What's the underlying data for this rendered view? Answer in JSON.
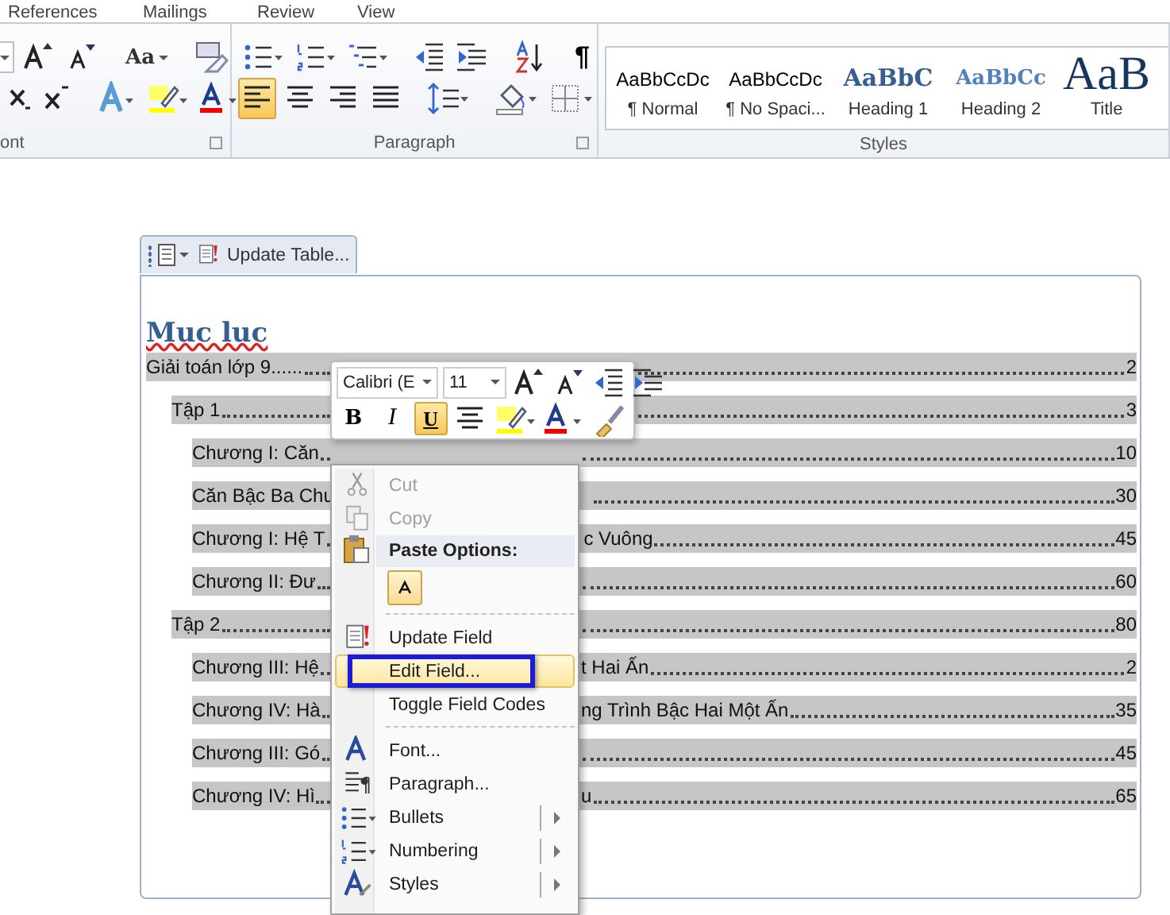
{
  "ribbon_tabs": [
    {
      "label": "References"
    },
    {
      "label": "Mailings"
    },
    {
      "label": "Review"
    },
    {
      "label": "View"
    }
  ],
  "ribbon": {
    "font_group": {
      "label": "ont",
      "row_1": [
        {
          "kind": "sizefield"
        },
        {
          "kind": "grow"
        },
        {
          "kind": "shrink"
        },
        {
          "kind": "sep"
        },
        {
          "kind": "case",
          "label": "Aa"
        },
        {
          "kind": "sep"
        },
        {
          "kind": "clear"
        }
      ],
      "row_2": [
        {
          "kind": "subscript"
        },
        {
          "kind": "superscript"
        },
        {
          "kind": "sep"
        },
        {
          "kind": "effects"
        },
        {
          "kind": "highlight"
        },
        {
          "kind": "fontcolor"
        }
      ]
    },
    "paragraph_group": {
      "label": "Paragraph",
      "row_1": [
        {
          "kind": "bullets"
        },
        {
          "kind": "numbering"
        },
        {
          "kind": "multilevel"
        },
        {
          "kind": "sep"
        },
        {
          "kind": "outdent"
        },
        {
          "kind": "indent"
        },
        {
          "kind": "sep"
        },
        {
          "kind": "sort"
        },
        {
          "kind": "sep"
        },
        {
          "kind": "pilcrow",
          "label": "¶"
        }
      ],
      "alignment": [
        {
          "kind": "left",
          "selected": true
        },
        {
          "kind": "center",
          "selected": false
        },
        {
          "kind": "right",
          "selected": false
        },
        {
          "kind": "justify",
          "selected": false
        }
      ],
      "row_2": [
        {
          "kind": "sep"
        },
        {
          "kind": "spacing"
        },
        {
          "kind": "sep"
        },
        {
          "kind": "shading"
        },
        {
          "kind": "borders"
        }
      ]
    },
    "styles_group": {
      "label": "Styles",
      "styles": [
        {
          "kind": "body",
          "preview": "AaBbCcDc",
          "label": "¶ Normal"
        },
        {
          "kind": "body",
          "preview": "AaBbCcDc",
          "label": "¶ No Spaci..."
        },
        {
          "kind": "heading1",
          "preview": "AaBbC",
          "label": "Heading 1"
        },
        {
          "kind": "heading2",
          "preview": "AaBbCc",
          "label": "Heading 2"
        },
        {
          "kind": "title",
          "preview": "AaB",
          "label": "Title"
        }
      ]
    }
  },
  "content_control": {
    "tab_label": "Update Table...",
    "heading": "Muc luc",
    "heading_spelling_error": true,
    "toc": [
      {
        "text": "Giải toán lớp 9......",
        "page": "2",
        "children": [
          {
            "text": "Tập 1",
            "page": "3",
            "children": [
              {
                "text": "Chương I: Căn",
                "page": "10"
              },
              {
                "text": "Căn Bậc Ba Chu",
                "page": "30"
              },
              {
                "text": "Chương I: Hệ T",
                "text_after": "c Vuông",
                "page": "45"
              },
              {
                "text": "Chương II: Đư",
                "page": "60"
              }
            ]
          },
          {
            "text": "Tập 2",
            "page": "80",
            "children": [
              {
                "text": "Chương III: Hệ",
                "text_after": "t Hai Ấn",
                "page": "2"
              },
              {
                "text": "Chương IV: Hà",
                "text_after": "ng Trình Bậc Hai Một Ấn",
                "page": "35"
              },
              {
                "text": "Chương III: Gó",
                "page": "45"
              },
              {
                "text": "Chương IV: Hì",
                "text_after": "u",
                "page": "65"
              }
            ]
          }
        ]
      }
    ]
  },
  "mini_toolbar": {
    "font": "Calibri (E",
    "size": "11",
    "row_1": [
      {
        "kind": "grow"
      },
      {
        "kind": "shrink"
      },
      {
        "kind": "outdent"
      },
      {
        "kind": "indent"
      }
    ],
    "row_2": [
      {
        "kind": "bold",
        "label": "B",
        "on": false
      },
      {
        "kind": "italic",
        "label": "I",
        "on": false
      },
      {
        "kind": "underline",
        "label": "U",
        "on": true
      },
      {
        "kind": "center"
      },
      {
        "kind": "highlight"
      },
      {
        "kind": "fontcolor"
      },
      {
        "kind": "painter"
      }
    ]
  },
  "context_menu": [
    {
      "kind": "cut",
      "label": "Cut",
      "disabled": true,
      "selected": false,
      "boxed": false
    },
    {
      "kind": "copy",
      "label": "Copy",
      "disabled": true,
      "selected": false,
      "boxed": false
    },
    {
      "kind": "header",
      "label": "Paste Options:"
    },
    {
      "kind": "paste"
    },
    {
      "kind": "separator"
    },
    {
      "kind": "update",
      "label": "Update Field",
      "disabled": false,
      "selected": false,
      "boxed": false
    },
    {
      "kind": "plain",
      "label": "Edit Field...",
      "disabled": false,
      "selected": true,
      "boxed": true
    },
    {
      "kind": "plain",
      "label": "Toggle Field Codes",
      "disabled": false,
      "selected": false,
      "boxed": false
    },
    {
      "kind": "separator"
    },
    {
      "kind": "font",
      "label": "Font...",
      "disabled": false,
      "selected": false,
      "boxed": false
    },
    {
      "kind": "paragraph",
      "label": "Paragraph...",
      "disabled": false,
      "selected": false,
      "boxed": false
    },
    {
      "kind": "bullets",
      "label": "Bullets",
      "disabled": false,
      "selected": false,
      "boxed": false,
      "submenu": true
    },
    {
      "kind": "numbering",
      "label": "Numbering",
      "disabled": false,
      "selected": false,
      "boxed": false,
      "submenu": true
    },
    {
      "kind": "styles",
      "label": "Styles",
      "disabled": false,
      "selected": false,
      "boxed": false,
      "submenu": true
    }
  ]
}
